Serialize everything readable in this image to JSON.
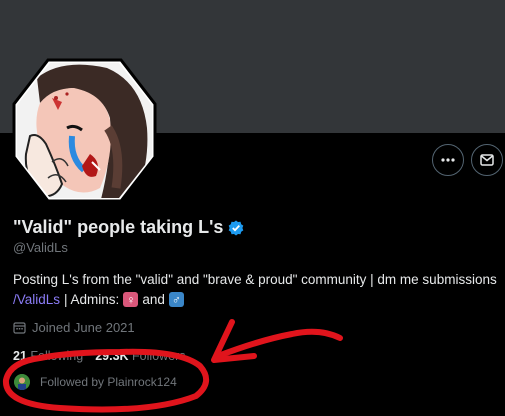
{
  "profile": {
    "display_name": "\"Valid\" people taking L's",
    "handle": "@ValidLs",
    "bio_line1": "Posting L's from the \"valid\" and \"brave & proud\" community | dm me submissions",
    "bio_link": "/ValidLs",
    "bio_admins_label": "| Admins:",
    "bio_and": "and",
    "admin_icon_1": "female-sign",
    "admin_icon_2": "male-sign",
    "joined": "Joined June 2021",
    "following_count": "21",
    "following_label": "Following",
    "followers_count": "29.3K",
    "followers_label": "Followers",
    "followed_by": "Followed by Plainrock124"
  },
  "actions": {
    "more_icon": "more-icon",
    "message_icon": "mail-icon"
  },
  "colors": {
    "accent": "#1d9bf0",
    "link_purple": "#8b7cf6",
    "annotation_red": "#e0141c",
    "banner": "#333639"
  }
}
